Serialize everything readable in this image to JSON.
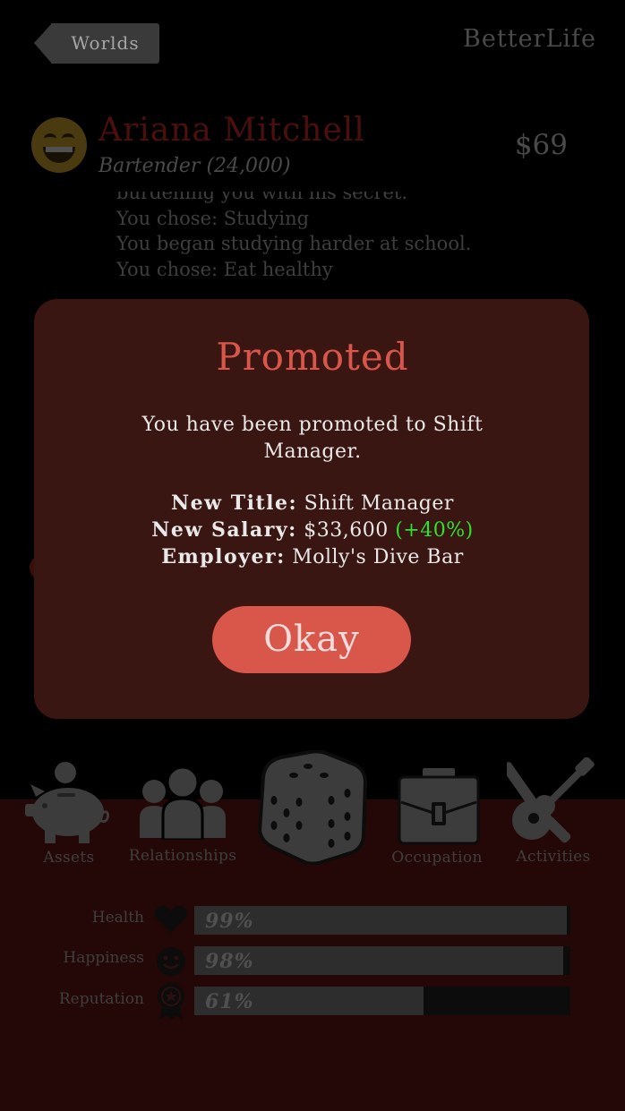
{
  "header": {
    "back_label": "Worlds",
    "app_name": "BetterLife"
  },
  "character": {
    "name": "Ariana Mitchell",
    "job": "Bartender (24,000)",
    "money": "$69"
  },
  "log": [
    "burdening you with his secret.",
    "You chose: Studying",
    "You began studying harder at school.",
    "You chose: Eat healthy"
  ],
  "modal": {
    "title": "Promoted",
    "message": "You have been promoted to Shift Manager.",
    "title_label": "New Title:",
    "title_value": "Shift Manager",
    "salary_label": "New Salary:",
    "salary_value": "$33,600",
    "salary_change": "(+40%)",
    "employer_label": "Employer:",
    "employer_value": "Molly's Dive Bar",
    "ok_label": "Okay"
  },
  "nav": {
    "assets": "Assets",
    "relationships": "Relationships",
    "occupation": "Occupation",
    "activities": "Activities"
  },
  "stats": {
    "health": {
      "label": "Health",
      "value": "99%",
      "level": 0.99
    },
    "happiness": {
      "label": "Happiness",
      "value": "98%",
      "level": 0.98
    },
    "reputation": {
      "label": "Reputation",
      "value": "61%",
      "level": 0.61
    }
  },
  "colors": {
    "accent": "#d9574a",
    "modal_bg": "#3a1612",
    "positive": "#2ee32e",
    "bottom_bg": "#240707"
  },
  "icons": {
    "assets": "piggy-bank-icon",
    "relationships": "people-icon",
    "roll": "dice-icon",
    "occupation": "briefcase-icon",
    "activities": "guitar-icon",
    "health": "heart-icon",
    "happiness": "smiley-icon",
    "reputation": "award-icon"
  }
}
